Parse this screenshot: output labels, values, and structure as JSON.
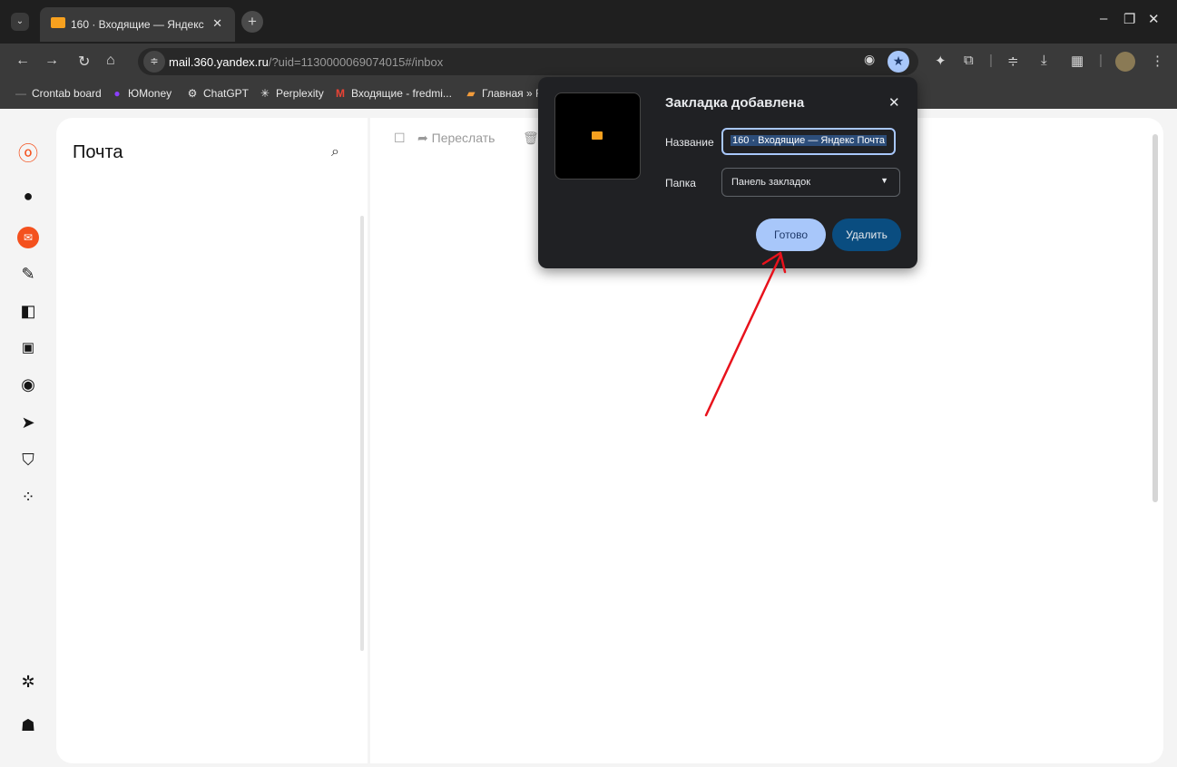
{
  "browser": {
    "tab_title": "160 · Входящие — Яндекс Почта",
    "new_tab_symbol": "+",
    "url_host": "mail.360.yandex.ru",
    "url_path": "/?uid=1130000069074015#/inbox"
  },
  "bookmarks": [
    {
      "label": "Crontab board",
      "icon": "crontab-icon"
    },
    {
      "label": "ЮMoney",
      "icon": "yoomoney-icon"
    },
    {
      "label": "ChatGPT",
      "icon": "chatgpt-icon"
    },
    {
      "label": "Perplexity",
      "icon": "perplexity-icon"
    },
    {
      "label": "Входящие - fredmi...",
      "icon": "gmail-icon"
    },
    {
      "label": "Главная » F",
      "icon": "bookmark-folder-icon"
    }
  ],
  "mail": {
    "pane_title": "Почта",
    "forward_label": "Переслать"
  },
  "popup": {
    "title": "Закладка добавлена",
    "name_label": "Название",
    "name_value": "160 · Входящие — Яндекс Почта",
    "folder_label": "Папка",
    "folder_value": "Панель закладок",
    "done_label": "Готово",
    "delete_label": "Удалить"
  },
  "colors": {
    "accent_orange": "#f7a11f",
    "done_button": "#a8c7fa",
    "delete_button": "#0a4d80",
    "annotation_arrow": "#e8121c"
  }
}
